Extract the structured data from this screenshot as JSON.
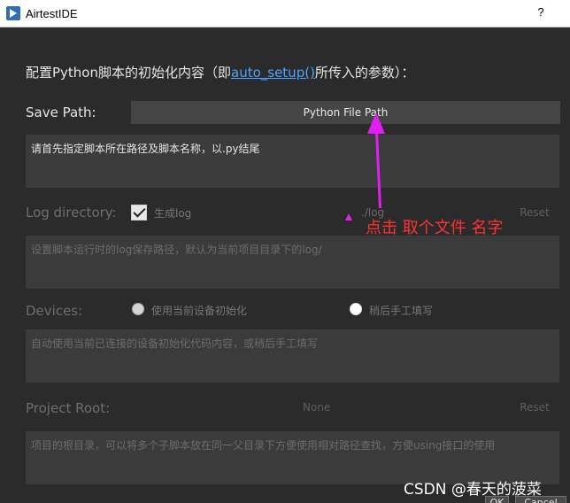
{
  "window": {
    "title": "AirtestIDE",
    "help_label": "?"
  },
  "intro": {
    "prefix": "配置Python脚本的初始化内容（即",
    "link": "auto_setup()",
    "suffix": "所传入的参数）："
  },
  "save_path": {
    "label": "Save Path:",
    "button": "Python File Path",
    "description": "请首先指定脚本所在路径及脚本名称，以.py结尾"
  },
  "log_directory": {
    "label": "Log directory:",
    "checkbox_label": "生成log",
    "checked": true,
    "value": "./log",
    "reset": "Reset",
    "description": "设置脚本运行时的log保存路径，默认为当前项目目录下的log/"
  },
  "devices": {
    "label": "Devices:",
    "option_current": "使用当前设备初始化",
    "option_manual": "稍后手工填写",
    "description": "自动使用当前已连接的设备初始化代码内容，或稍后手工填写"
  },
  "project_root": {
    "label": "Project Root:",
    "value": "None",
    "reset": "Reset",
    "description": "项目的根目录，可以将多个子脚本放在同一父目录下方便使用相对路径查找，方便using接口的使用"
  },
  "annotation": {
    "text": "点击 取个文件 名字",
    "color": "#ff3333",
    "arrow_color": "#e020f0"
  },
  "watermark": "CSDN @春天的菠菜",
  "bottom_buttons": {
    "ok": "OK",
    "cancel": "Cancel"
  }
}
